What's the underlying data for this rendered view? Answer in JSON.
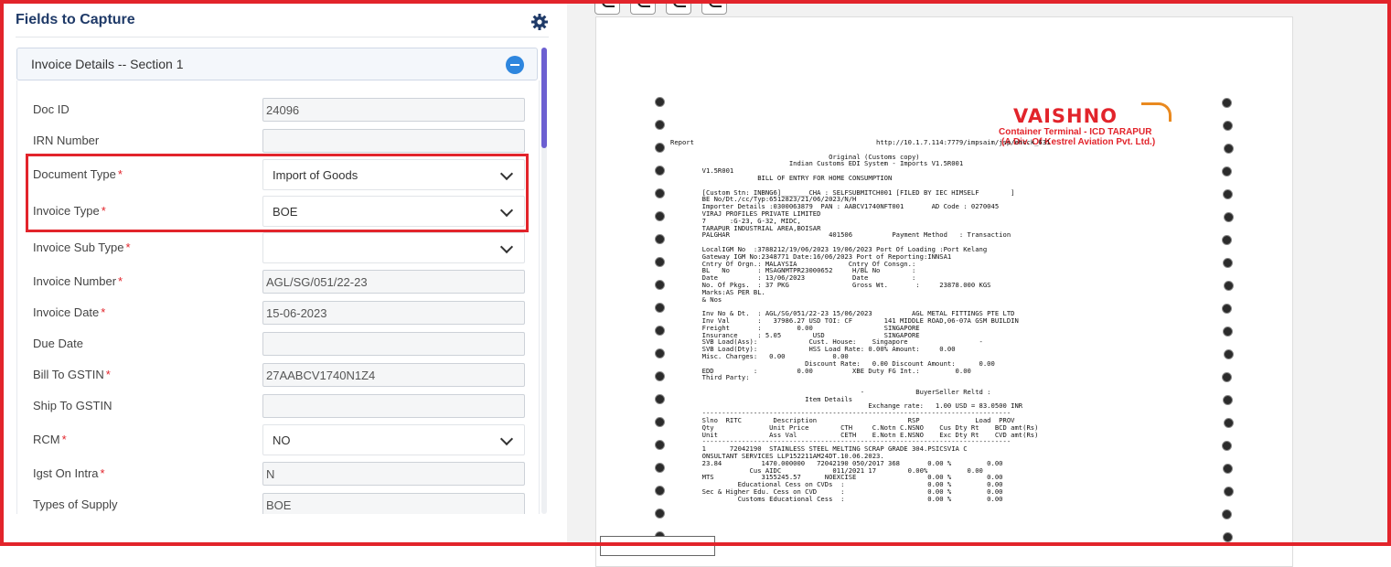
{
  "panel": {
    "title": "Fields to Capture",
    "settings_icon": "gear-icon"
  },
  "section": {
    "title": "Invoice Details -- Section 1",
    "toggle_icon": "minus-circle-icon"
  },
  "fields": [
    {
      "label": "Doc ID",
      "required": false,
      "type": "text",
      "value": "24096"
    },
    {
      "label": "IRN Number",
      "required": false,
      "type": "text",
      "value": ""
    },
    {
      "label": "Document Type",
      "required": true,
      "type": "select",
      "value": "Import of Goods"
    },
    {
      "label": "Invoice Type",
      "required": true,
      "type": "select",
      "value": "BOE"
    },
    {
      "label": "Invoice Sub Type",
      "required": true,
      "type": "select",
      "value": ""
    },
    {
      "label": "Invoice Number",
      "required": true,
      "type": "text",
      "value": "AGL/SG/051/22-23"
    },
    {
      "label": "Invoice Date",
      "required": true,
      "type": "text",
      "value": "15-06-2023"
    },
    {
      "label": "Due Date",
      "required": false,
      "type": "text",
      "value": ""
    },
    {
      "label": "Bill To GSTIN",
      "required": true,
      "type": "text",
      "value": "27AABCV1740N1Z4"
    },
    {
      "label": "Ship To GSTIN",
      "required": false,
      "type": "text",
      "value": ""
    },
    {
      "label": "RCM",
      "required": true,
      "type": "select",
      "value": "NO"
    },
    {
      "label": "Igst On Intra",
      "required": true,
      "type": "text",
      "value": "N"
    },
    {
      "label": "Types of Supply",
      "required": false,
      "type": "text",
      "value": "BOE"
    }
  ],
  "required_marker": "*",
  "viewer": {
    "toolbar": [
      "rotate-left-icon",
      "rotate-right-icon",
      "zoom-in-icon",
      "zoom-out-icon"
    ],
    "logo": {
      "name": "VAISHNO",
      "line1": "Container Terminal - ICD TARAPUR",
      "line2": "(A Div. Of Kestrel Aviation Pvt. Ltd.)"
    },
    "doc_lines": [
      "Report                                              http://10.1.7.114:7779/impsaim/jsp/ehcck_631",
      "",
      "                                        Original (Customs copy)",
      "                              Indian Customs EDI System - Imports V1.5R001",
      "        V1.5R001",
      "                      BILL OF ENTRY FOR HOME CONSUMPTION",
      "",
      "        [Custom Stn: INBNG6]_______CHA : SELFSUBMITCH001 [FILED BY IEC HIMSELF        ]",
      "        BE No/Dt./cc/Typ:6512823/21/06/2023/N/H",
      "        Importer Details :0300063879  PAN : AABCV1740NFT001       AD Code : 0270045",
      "        VIRAJ PROFILES PRIVATE LIMITED",
      "        7      :G-23, G-32, MIDC,",
      "        TARAPUR INDUSTRIAL AREA,BOISAR",
      "        PALGHAR                         401506          Payment Method   : Transaction",
      "",
      "        LocalIGM No  :3788212/19/06/2023 19/06/2023 Port Of Loading :Port Kelang",
      "        Gateway IGM No:2348771 Date:16/06/2023 Port of Reporting:INNSA1",
      "        Cntry Of Orgn.: MALAYSIA             Cntry Of Consgn.:",
      "        BL   No       : MSAGNMTPR23000652     H/BL No        :",
      "        Date          : 13/06/2023            Date           :",
      "        No. Of Pkgs.  : 37 PKG                Gross Wt.       :     23878.000 KGS",
      "        Marks:AS PER BL.",
      "        & Nos",
      "",
      "        Inv No & Dt.  : AGL/SG/051/22-23 15/06/2023          AGL METAL FITTINGS PTE LTD",
      "        Inv Val       :   37986.27 USD TOI: CF        141 MIDDLE ROAD,06-07A GSM BUILDIN",
      "        Freight       :         0.00                  SINGAPORE",
      "        Insurance     : 5.05        USD               SINGAPORE",
      "        SVB Load(Ass):             Cust. House:    Singapore                  -",
      "        SVB Load(Dty):             HSS Load Rate: 0.00% Amount:     0.00",
      "        Misc. Charges:   0.00            0.00",
      "                                  Discount Rate:   0.00 Discount Amount:      0.00",
      "        EDD          :          0.00          XBE Duty FG Int.:         0.00",
      "        Third Party:",
      "",
      "                                                -             BuyerSeller Reltd :",
      "                                  Item Details",
      "                                                  Exchange rate:   1.00 USD = 83.0500 INR",
      "        ------------------------------------------------------------------------------",
      "        Slno  RITC        Description                       RSP              Load  PROV",
      "        Qty              Unit Price        CTH     C.Notn C.NSNO    Cus Dty Rt    BCD amt(Rs)",
      "        Unit             Ass Val           CETH    E.Notn E.NSNO    Exc Dty Rt    CVD amt(Rs)",
      "        ------------------------------------------------------------------------------",
      "        1      72042190  STAINLESS STEEL MELTING SCRAP GRADE 304.PSICSVIA C",
      "        ONSULTANT SERVICES LLP152211AM24DT.10.06.2023.",
      "        23.84          1470.000000   72042190 050/2017 368       0.00 %         0.00",
      "                    Cus AIDC             011/2021 17        0.00%          0.00",
      "        MTS            3155245.57      NOEXCISE                  0.00 %         0.00",
      "                 Educational Cess on CVDs  :                     0.00 %         0.00",
      "        Sec & Higher Edu. Cess on CVD      :                     0.00 %         0.00",
      "                 Customs Educational Cess  :                     0.00 %         0.00"
    ]
  }
}
